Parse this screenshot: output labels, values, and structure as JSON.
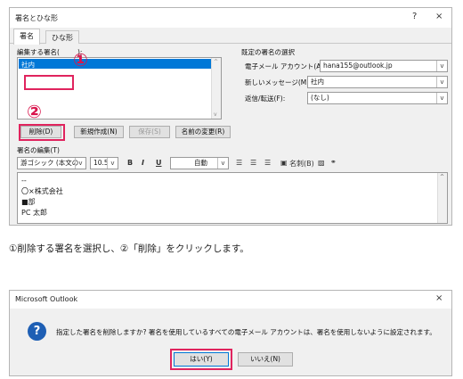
{
  "dialog1": {
    "title": "署名とひな形",
    "help": "?",
    "close": "×",
    "tabs": [
      "署名",
      "ひな形"
    ],
    "edit_signature_label": "編集する署名(",
    "edit_signature_label_tail": ");",
    "signature_list": [
      "社内"
    ],
    "default_signature_label": "既定の署名の選択",
    "email_account_label": "電子メール アカウント(A):",
    "email_account_value": "hana155@outlook.jp",
    "new_messages_label": "新しいメッセージ(M):",
    "new_messages_value": "社内",
    "replies_label": "返信/転送(F):",
    "replies_value": "(なし)",
    "buttons": {
      "delete": "削除(D)",
      "new": "新規作成(N)",
      "save": "保存(S)",
      "rename": "名前の変更(R)"
    },
    "edit_section_label": "署名の編集(T)",
    "toolbar": {
      "font": "游ゴシック (本文の",
      "size": "10.5",
      "bold": "B",
      "italic": "I",
      "underline": "U",
      "color": "自動",
      "business_card": "名刺(B)"
    },
    "signature_body": [
      "--",
      "〇×株式会社",
      "■部",
      "PC 太郎"
    ],
    "step_labels": [
      "①",
      "②"
    ]
  },
  "caption": "①削除する署名を選択し、②「削除」をクリックします。",
  "dialog2": {
    "title": "Microsoft Outlook",
    "close": "×",
    "icon": "?",
    "message": "指定した署名を削除しますか? 署名を使用しているすべての電子メール アカウントは、署名を使用しないように設定されます。",
    "yes": "はい(Y)",
    "no": "いいえ(N)"
  }
}
